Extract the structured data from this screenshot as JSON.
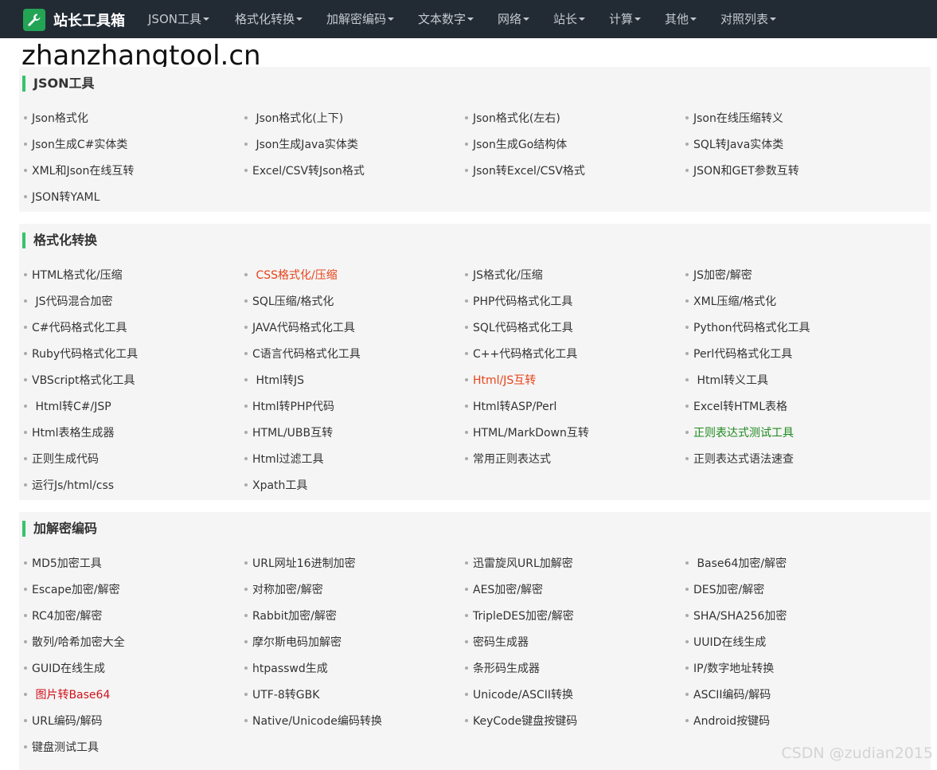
{
  "navbar": {
    "brand": "站长工具箱",
    "items": [
      {
        "label": "JSON工具"
      },
      {
        "label": "格式化转换"
      },
      {
        "label": "加解密编码"
      },
      {
        "label": "文本数字"
      },
      {
        "label": "网络"
      },
      {
        "label": "站长"
      },
      {
        "label": "计算"
      },
      {
        "label": "其他"
      },
      {
        "label": "对照列表"
      }
    ]
  },
  "site_url": "zhanzhangtool.cn",
  "colors": {
    "nav_bg": "#222b34",
    "brand_green": "#23a455",
    "section_bar": "#37c26e",
    "link_red": "#e8431a",
    "link_green": "#1e8a1e",
    "link_dark_red": "#d0121b"
  },
  "sections": [
    {
      "title": "JSON工具",
      "links": [
        {
          "label": "Json格式化"
        },
        {
          "label": " Json格式化(上下)"
        },
        {
          "label": "Json格式化(左右)"
        },
        {
          "label": "Json在线压缩转义"
        },
        {
          "label": "Json生成C#实体类"
        },
        {
          "label": " Json生成Java实体类"
        },
        {
          "label": "Json生成Go结构体"
        },
        {
          "label": "SQL转Java实体类"
        },
        {
          "label": "XML和Json在线互转"
        },
        {
          "label": "Excel/CSV转Json格式"
        },
        {
          "label": "Json转Excel/CSV格式"
        },
        {
          "label": "JSON和GET参数互转"
        },
        {
          "label": "JSON转YAML"
        }
      ]
    },
    {
      "title": "格式化转换",
      "links": [
        {
          "label": "HTML格式化/压缩"
        },
        {
          "label": " CSS格式化/压缩",
          "color": "red"
        },
        {
          "label": "JS格式化/压缩"
        },
        {
          "label": "JS加密/解密"
        },
        {
          "label": " JS代码混合加密"
        },
        {
          "label": "SQL压缩/格式化"
        },
        {
          "label": "PHP代码格式化工具"
        },
        {
          "label": "XML压缩/格式化"
        },
        {
          "label": "C#代码格式化工具"
        },
        {
          "label": "JAVA代码格式化工具"
        },
        {
          "label": "SQL代码格式化工具"
        },
        {
          "label": "Python代码格式化工具"
        },
        {
          "label": "Ruby代码格式化工具"
        },
        {
          "label": "C语言代码格式化工具"
        },
        {
          "label": "C++代码格式化工具"
        },
        {
          "label": "Perl代码格式化工具"
        },
        {
          "label": "VBScript格式化工具"
        },
        {
          "label": " Html转JS"
        },
        {
          "label": "Html/JS互转",
          "color": "red"
        },
        {
          "label": " Html转义工具"
        },
        {
          "label": " Html转C#/JSP"
        },
        {
          "label": "Html转PHP代码"
        },
        {
          "label": "Html转ASP/Perl"
        },
        {
          "label": "Excel转HTML表格"
        },
        {
          "label": "Html表格生成器"
        },
        {
          "label": "HTML/UBB互转"
        },
        {
          "label": "HTML/MarkDown互转"
        },
        {
          "label": "正则表达式测试工具",
          "color": "green"
        },
        {
          "label": "正则生成代码"
        },
        {
          "label": "Html过滤工具"
        },
        {
          "label": "常用正则表达式"
        },
        {
          "label": "正则表达式语法速查"
        },
        {
          "label": "运行Js/html/css"
        },
        {
          "label": "Xpath工具"
        }
      ]
    },
    {
      "title": "加解密编码",
      "links": [
        {
          "label": "MD5加密工具"
        },
        {
          "label": "URL网址16进制加密"
        },
        {
          "label": "迅雷旋风URL加解密"
        },
        {
          "label": " Base64加密/解密"
        },
        {
          "label": "Escape加密/解密"
        },
        {
          "label": "对称加密/解密"
        },
        {
          "label": "AES加密/解密"
        },
        {
          "label": "DES加密/解密"
        },
        {
          "label": "RC4加密/解密"
        },
        {
          "label": "Rabbit加密/解密"
        },
        {
          "label": "TripleDES加密/解密"
        },
        {
          "label": "SHA/SHA256加密"
        },
        {
          "label": "散列/哈希加密大全"
        },
        {
          "label": "摩尔斯电码加解密"
        },
        {
          "label": "密码生成器"
        },
        {
          "label": "UUID在线生成"
        },
        {
          "label": "GUID在线生成"
        },
        {
          "label": "htpasswd生成"
        },
        {
          "label": "条形码生成器"
        },
        {
          "label": "IP/数字地址转换"
        },
        {
          "label": " 图片转Base64",
          "color": "darkred"
        },
        {
          "label": "UTF-8转GBK"
        },
        {
          "label": "Unicode/ASCII转换"
        },
        {
          "label": "ASCII编码/解码"
        },
        {
          "label": "URL编码/解码"
        },
        {
          "label": "Native/Unicode编码转换"
        },
        {
          "label": "KeyCode键盘按键码"
        },
        {
          "label": "Android按键码"
        },
        {
          "label": "键盘测试工具"
        }
      ]
    }
  ],
  "watermark": "CSDN @zudian2015"
}
